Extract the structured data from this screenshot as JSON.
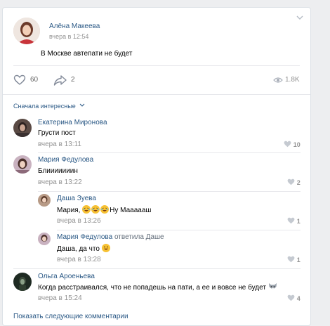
{
  "post": {
    "author": "Алёна Макеева",
    "time": "вчера в 12:54",
    "text": "В Москве автепати не будет",
    "likes": "60",
    "shares": "2",
    "views": "1.8K"
  },
  "comments_header": {
    "sort_label": "Сначала интересные"
  },
  "comments": [
    {
      "author": "Екатерина Миронова",
      "text": "Грусти пост",
      "time": "вчера в 13:11",
      "likes": "10"
    },
    {
      "author": "Мария Федулова",
      "text": "Блииииииин",
      "time": "вчера в 13:22",
      "likes": "2"
    },
    {
      "author": "Даша Зуева",
      "text_prefix": "Мария, ",
      "text_suffix": "Ну Маааааш",
      "time": "вчера в 13:26",
      "likes": "1"
    },
    {
      "author": "Мария Федулова",
      "reply_to": "ответила Даше",
      "text": "Даша, да что",
      "time": "вчера в 13:28",
      "likes": "1"
    },
    {
      "author": "Ольга Ароеньева",
      "text": "Когда расстраивался, что не попадешь на пати, а ее и вовсе не будет",
      "time": "вчера в 15:24",
      "likes": "4"
    }
  ],
  "footer": {
    "show_more": "Показать следующие комментарии"
  },
  "colors": {
    "link": "#2a5885",
    "meta": "#939393",
    "divider": "#e7e8ec",
    "background": "#edeef0"
  }
}
